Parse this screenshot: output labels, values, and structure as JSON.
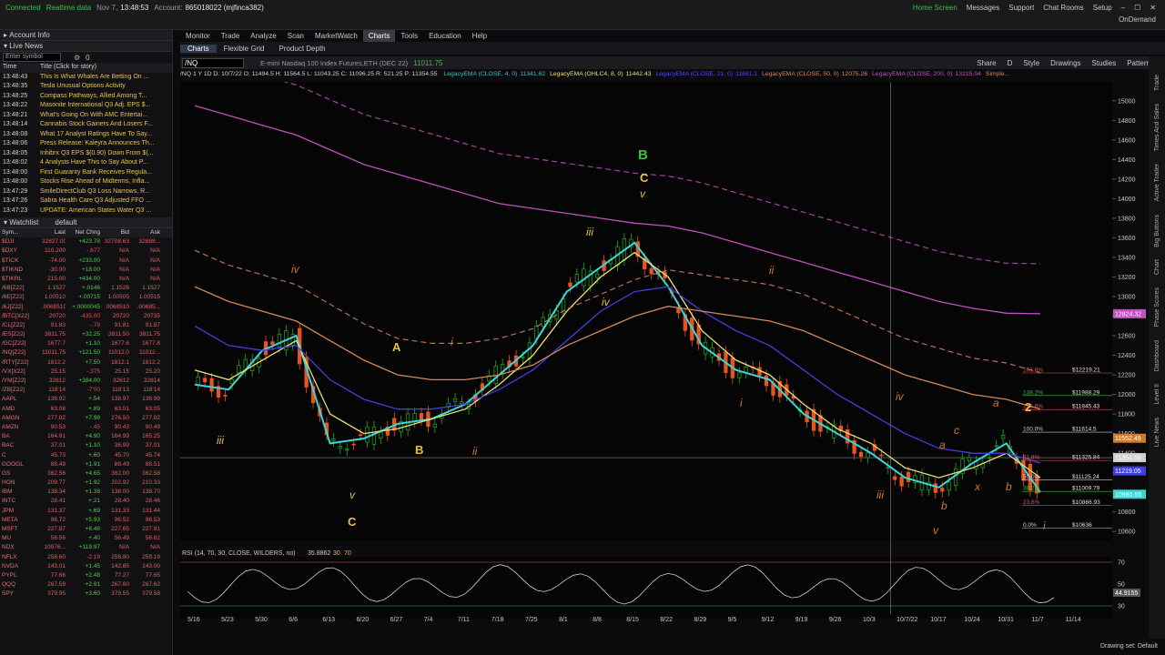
{
  "status": {
    "connection": "Connected",
    "data_mode": "Realtime data",
    "date": "Nov 7,",
    "time": "13:48:53",
    "account_label": "Account:",
    "account": "865018022 (mjfinca382)"
  },
  "top_links": [
    "Home Screen",
    "Messages",
    "Support",
    "Chat Rooms",
    "Setup"
  ],
  "on_demand": "OnDemand",
  "account_info": "Account Info",
  "live_news": {
    "title": "Live News",
    "enter_symbol": "Enter symbol",
    "count": "0",
    "col_time": "Time",
    "col_title": "Title (Click for story)",
    "items": [
      {
        "time": "13:48:43",
        "title": "This Is What Whales Are Betting On ..."
      },
      {
        "time": "13:48:35",
        "title": "Tesla Unusual Options Activity"
      },
      {
        "time": "13:48:25",
        "title": "Compass Pathways, Allied Among T..."
      },
      {
        "time": "13:48:22",
        "title": "Masonite International Q3 Adj. EPS $..."
      },
      {
        "time": "13:48:21",
        "title": "What's Going On With AMC Entertai..."
      },
      {
        "time": "13:48:14",
        "title": "Cannabis Stock Gainers And Losers F..."
      },
      {
        "time": "13:48:08",
        "title": "What 17 Analyst Ratings Have To Say..."
      },
      {
        "time": "13:48:06",
        "title": "Press Release: Kaleyra Announces Th..."
      },
      {
        "time": "13:48:05",
        "title": "Inhibrx Q3 EPS $(0.90) Down From $(..."
      },
      {
        "time": "13:48:02",
        "title": "4 Analysts Have This to Say About P..."
      },
      {
        "time": "13:48:00",
        "title": "First Guaranty Bank Receives Regula..."
      },
      {
        "time": "13:48:00",
        "title": "Stocks Rise Ahead of Midterms, Infla..."
      },
      {
        "time": "13:47:29",
        "title": "SmileDirectClub Q3 Loss Narrows, R..."
      },
      {
        "time": "13:47:26",
        "title": "Sabra Health Care Q3 Adjusted FFO ..."
      },
      {
        "time": "13:47:23",
        "title": "UPDATE: American States Water Q3 ..."
      }
    ]
  },
  "watchlist": {
    "title": "Watchlist",
    "name": "default",
    "headers": [
      "Sym...",
      "Last",
      "Net Chng",
      "Bid",
      "Ask"
    ],
    "rows": [
      [
        "$DJI",
        "32827.00",
        "+423.78",
        "32708.63",
        "32888..."
      ],
      [
        "$DXY",
        "110.200",
        "-.677",
        "N/A",
        "N/A"
      ],
      [
        "$TICK",
        "-74.00",
        "+233.00",
        "N/A",
        "N/A"
      ],
      [
        "$TIKND",
        "-30.00",
        "+18.00",
        "N/A",
        "N/A"
      ],
      [
        "$TIKRL",
        "215.00",
        "+434.00",
        "N/A",
        "N/A"
      ],
      [
        "/6B[Z22]",
        "1.1527",
        "+.0146",
        "1.1526",
        "1.1527"
      ],
      [
        "/6E[Z22]",
        "1.00510",
        "+.00715",
        "1.00505",
        "1.00515"
      ],
      [
        "/6J[Z22]",
        ".0068510",
        "+.0000045",
        ".0068510",
        ".00685..."
      ],
      [
        "/BTC[X22]",
        "20720",
        "-435.00",
        "20720",
        "20735"
      ],
      [
        "/CL[Z22]",
        "91.83",
        "-.78",
        "91.81",
        "91.87"
      ],
      [
        "/ES[Z22]",
        "3811.75",
        "+32.25",
        "3811.50",
        "3811.75"
      ],
      [
        "/GC[Z22]",
        "1677.7",
        "+1.10",
        "1677.6",
        "1677.8"
      ],
      [
        "/NQ[Z22]",
        "11011.75",
        "+121.50",
        "11012.0",
        "11012..."
      ],
      [
        "/RTY[Z22]",
        "1812.2",
        "+7.50",
        "1812.1",
        "1812.2"
      ],
      [
        "/VX[X22]",
        "25.15",
        "-.375",
        "25.15",
        "25.20"
      ],
      [
        "/YM[Z22]",
        "32812",
        "+384.00",
        "32812",
        "32814"
      ],
      [
        "/ZB[Z22]",
        "118'14",
        "-7'00",
        "118'13",
        "118'14"
      ],
      [
        "AAPL",
        "138.92",
        "+.54",
        "138.97",
        "138.99"
      ],
      [
        "AMD",
        "63.08",
        "+.89",
        "63.01",
        "63.05"
      ],
      [
        "AMGN",
        "277.02",
        "+7.98",
        "276.50",
        "277.02"
      ],
      [
        "AMZN",
        "90.53",
        "-.45",
        "90.43",
        "90.49"
      ],
      [
        "BA",
        "164.91",
        "+4.90",
        "164.99",
        "165.25"
      ],
      [
        "BAC",
        "37.01",
        "+1.10",
        "36.99",
        "37.01"
      ],
      [
        "C",
        "45.73",
        "+.60",
        "45.70",
        "45.74"
      ],
      [
        "GOOGL",
        "88.49",
        "+1.91",
        "88.49",
        "88.51"
      ],
      [
        "GS",
        "362.56",
        "+4.65",
        "362.00",
        "362.58"
      ],
      [
        "HON",
        "209.77",
        "+1.92",
        "202.92",
        "210.33"
      ],
      [
        "IBM",
        "138.34",
        "+1.38",
        "138.00",
        "138.70"
      ],
      [
        "INTC",
        "28.41",
        "+.21",
        "28.40",
        "28.46"
      ],
      [
        "JPM",
        "131.37",
        "+.69",
        "131.33",
        "131.44"
      ],
      [
        "META",
        "96.72",
        "+5.93",
        "96.52",
        "96.53"
      ],
      [
        "MSFT",
        "227.87",
        "+6.48",
        "227.65",
        "227.91"
      ],
      [
        "MU",
        "56.56",
        "+.40",
        "56.49",
        "56.62"
      ],
      [
        "NDX",
        "10976...",
        "+119.97",
        "N/A",
        "N/A"
      ],
      [
        "NFLX",
        "258.60",
        "-2.19",
        "258.80",
        "259.19"
      ],
      [
        "NVDA",
        "143.01",
        "+1.45",
        "142.85",
        "143.00"
      ],
      [
        "PYPL",
        "77.66",
        "+2.48",
        "77.27",
        "77.65"
      ],
      [
        "QQQ",
        "267.59",
        "+2.91",
        "267.60",
        "267.62"
      ],
      [
        "SPY",
        "379.95",
        "+3.60",
        "379.55",
        "379.58"
      ]
    ]
  },
  "nav": [
    "Monitor",
    "Trade",
    "Analyze",
    "Scan",
    "MarketWatch",
    "Charts",
    "Tools",
    "Education",
    "Help"
  ],
  "subnav": [
    "Charts",
    "Flexible Grid",
    "Product Depth"
  ],
  "chart_toolbar": {
    "symbol": "/NQ",
    "description": "E-mini Nasdaq 100 Index Futures,ETH (DEC 22)",
    "price": "11011.75",
    "tools": [
      "Share",
      "D",
      "Style",
      "Drawings",
      "Studies",
      "Patterns"
    ]
  },
  "study_bar": {
    "ohlc": "/NQ 1 Y 1D  D: 10/7/22  O: 11494.5  H: 11564.5  L: 11043.25  C: 11096.25  R: 521.25  P: 11354.55",
    "studies": [
      {
        "text": "LegacyEMA (CLOSE, 4, 0)",
        "value": "11341.62",
        "color": "#3fbfbf"
      },
      {
        "text": "LegacyEMA (OHLC4, 8, 0)",
        "value": "11442.43",
        "color": "#e8e07a"
      },
      {
        "text": "LegacyEMA (CLOSE, 21, 0)",
        "value": "11681.1",
        "color": "#4a4aff"
      },
      {
        "text": "LegacyEMA (CLOSE, 50, 0)",
        "value": "12075.26",
        "color": "#d4885a"
      },
      {
        "text": "LegacyEMA (CLOSE, 200, 0)",
        "value": "13215.04",
        "color": "#c050c0"
      },
      {
        "text": "Simple...",
        "value": "",
        "color": "#d4885a"
      }
    ]
  },
  "chart_data": {
    "type": "line",
    "title": "/NQ 1 Y 1D",
    "x_tick_labels": [
      "5/16",
      "5/23",
      "5/30",
      "6/6",
      "6/13",
      "6/20",
      "6/27",
      "7/4",
      "7/11",
      "7/18",
      "7/25",
      "8/1",
      "8/8",
      "8/15",
      "8/22",
      "8/29",
      "9/5",
      "9/12",
      "9/19",
      "9/26",
      "10/3",
      "10/7/22",
      "10/17",
      "10/24",
      "10/31",
      "11/7",
      "11/14"
    ],
    "y_tick_labels": [
      "15000",
      "14800",
      "14600",
      "14400",
      "14200",
      "14000",
      "13800",
      "13600",
      "13400",
      "13200",
      "13000",
      "12800",
      "12600",
      "12400",
      "12200",
      "12000",
      "11800",
      "11600",
      "11400",
      "11200",
      "11000",
      "10800",
      "10600"
    ],
    "ylim": [
      10500,
      15100
    ],
    "x_dates": [
      "2022-05-16",
      "2022-05-23",
      "2022-05-30",
      "2022-06-06",
      "2022-06-13",
      "2022-06-20",
      "2022-06-27",
      "2022-07-04",
      "2022-07-11",
      "2022-07-18",
      "2022-07-25",
      "2022-08-01",
      "2022-08-08",
      "2022-08-15",
      "2022-08-22",
      "2022-08-29",
      "2022-09-05",
      "2022-09-12",
      "2022-09-19",
      "2022-09-26",
      "2022-10-03",
      "2022-10-10",
      "2022-10-17",
      "2022-10-24",
      "2022-10-31",
      "2022-11-07"
    ],
    "series": [
      {
        "color": "#3fd4d4",
        "values": [
          12100,
          12050,
          12450,
          12600,
          11500,
          11550,
          11700,
          11750,
          11900,
          12200,
          12500,
          13050,
          13300,
          13550,
          13100,
          12500,
          12250,
          12150,
          11800,
          11600,
          11400,
          11150,
          11050,
          11300,
          11500,
          11000
        ]
      },
      {
        "color": "#e8e07a",
        "values": [
          12250,
          12150,
          12350,
          12550,
          11800,
          11600,
          11650,
          11750,
          11850,
          12100,
          12400,
          12850,
          13200,
          13450,
          13200,
          12650,
          12350,
          12200,
          11900,
          11650,
          11500,
          11250,
          11150,
          11250,
          11400,
          11150
        ]
      },
      {
        "color": "#4040e0",
        "values": [
          12700,
          12500,
          12450,
          12500,
          12150,
          11950,
          11850,
          11850,
          11900,
          12050,
          12250,
          12550,
          12850,
          13050,
          13100,
          12850,
          12650,
          12500,
          12250,
          12000,
          11800,
          11600,
          11450,
          11400,
          11400,
          11300
        ]
      },
      {
        "color": "#d4885a",
        "values": [
          13100,
          12950,
          12850,
          12750,
          12550,
          12350,
          12200,
          12150,
          12150,
          12200,
          12300,
          12500,
          12650,
          12800,
          12900,
          12850,
          12800,
          12750,
          12650,
          12500,
          12350,
          12200,
          12100,
          12000,
          11950,
          11850
        ]
      },
      {
        "color": "#c050c0",
        "values": [
          14950,
          14850,
          14750,
          14650,
          14500,
          14350,
          14250,
          14150,
          14050,
          13950,
          13900,
          13850,
          13800,
          13750,
          13720,
          13650,
          13550,
          13450,
          13350,
          13250,
          13150,
          13050,
          12950,
          12880,
          12830,
          12824
        ]
      }
    ],
    "price_flags": [
      {
        "label": "12824.32",
        "color": "#c050c0"
      },
      {
        "label": "11552.49",
        "color": "#d07a2a"
      },
      {
        "label": "11354.55",
        "color": "#d0d0d0"
      },
      {
        "label": "11219.05",
        "color": "#4040e0"
      },
      {
        "label": "10980.55",
        "color": "#3fd4d4"
      }
    ],
    "fib_levels": [
      {
        "pct": "161.8%",
        "price": "$12219.21",
        "color": "#e05050"
      },
      {
        "pct": "138.2%",
        "price": "$11988.29",
        "color": "#3fbf3f"
      },
      {
        "pct": "123.6%",
        "price": "$11845.43",
        "color": "#e05050"
      },
      {
        "pct": "100.0%",
        "price": "$11614.5",
        "color": "#d0d0d0"
      },
      {
        "pct": "61.8%",
        "price": "$11325.84",
        "color": "#e05050"
      },
      {
        "pct": "50.0%",
        "price": "$11125.24",
        "color": "#d0d0d0"
      },
      {
        "pct": "38.2%",
        "price": "$11009.79",
        "color": "#3fbf3f"
      },
      {
        "pct": "23.6%",
        "price": "$10866.93",
        "color": "#e05050"
      },
      {
        "pct": "0.0%",
        "price": "$10636",
        "color": "#d0d0d0"
      }
    ],
    "wave_labels": [
      "iii",
      "v",
      "C",
      "iv",
      "A",
      "B",
      "i",
      "ii",
      "iii",
      "iv",
      "B",
      "C",
      "v",
      "ii",
      "i",
      "iv",
      "iii",
      "v",
      "a",
      "b",
      "c",
      "x",
      "a",
      "b",
      "2",
      "i"
    ],
    "rsi": {
      "label": "RSI (14, 70, 30, CLOSE, WILDERS, no)",
      "value": "35.8862",
      "levels": [
        "30",
        "70"
      ],
      "y_ticks": [
        "70",
        "50",
        "30"
      ],
      "last": "44.9155"
    }
  },
  "right_strip": [
    "Trade",
    "Times And Sales",
    "Active Trader",
    "Big Buttons",
    "Chart",
    "Phase Scores",
    "Dashboard",
    "Level II",
    "Live News"
  ],
  "bottom_status": "Drawing set: Default"
}
